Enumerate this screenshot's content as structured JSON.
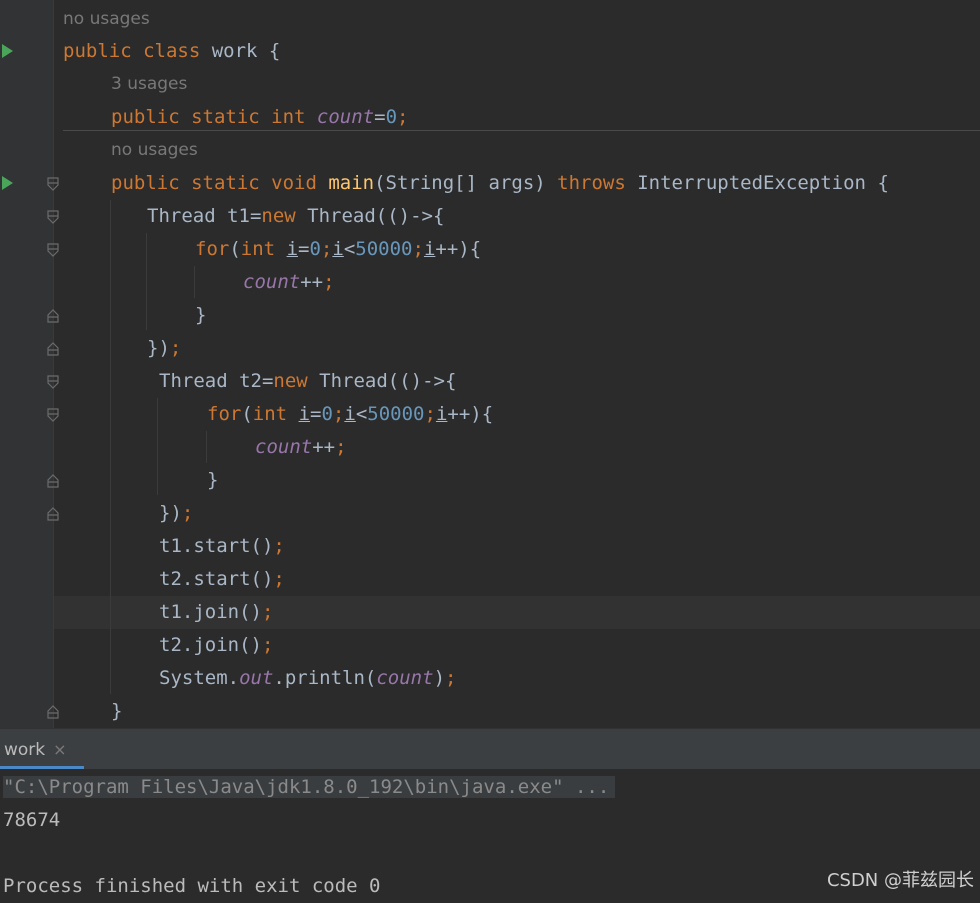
{
  "editor": {
    "hints": {
      "class_usages": "no usages",
      "count_usages": "3 usages",
      "main_usages": "no usages"
    },
    "code": {
      "l1": {
        "kw": "public class ",
        "name": "work",
        "rest": " {"
      },
      "l2": {
        "kw": "public static int ",
        "var": "count",
        "eq": "=",
        "num": "0",
        "semi": ";"
      },
      "l3": {
        "kw": "public static void ",
        "fn": "main",
        "args": "(String[] args) ",
        "throws": "throws",
        "exc": " InterruptedException {"
      },
      "l4": {
        "a": "Thread t1=",
        "kw": "new",
        "b": " Thread(()->{"
      },
      "l5": {
        "kw": "for",
        "a": "(",
        "kw2": "int",
        "sp": " ",
        "i1": "i",
        "eq": "=",
        "n0": "0",
        "s1": ";",
        "i2": "i",
        "lt": "<",
        "n1": "50000",
        "s2": ";",
        "i3": "i",
        "tail": "++){"
      },
      "l6": {
        "var": "count",
        "op": "++",
        "semi": ";"
      },
      "l7": {
        "brace": "}"
      },
      "l8": {
        "a": "})",
        "semi": ";"
      },
      "l9": {
        "a": "Thread t2=",
        "kw": "new",
        "b": " Thread(()->{"
      },
      "l10": {
        "kw": "for",
        "a": "(",
        "kw2": "int",
        "sp": " ",
        "i1": "i",
        "eq": "=",
        "n0": "0",
        "s1": ";",
        "i2": "i",
        "lt": "<",
        "n1": "50000",
        "s2": ";",
        "i3": "i",
        "tail": "++){"
      },
      "l11": {
        "var": "count",
        "op": "++",
        "semi": ";"
      },
      "l12": {
        "brace": "}"
      },
      "l13": {
        "a": "})",
        "semi": ";"
      },
      "l14": {
        "a": "t1.start()",
        "semi": ";"
      },
      "l15": {
        "a": "t2.start()",
        "semi": ";"
      },
      "l16": {
        "a": "t1.join()",
        "semi": ";"
      },
      "l17": {
        "a": "t2.join()",
        "semi": ";"
      },
      "l18": {
        "a": "System.",
        "out": "out",
        "b": ".println(",
        "var": "count",
        "c": ")",
        "semi": ";"
      },
      "l19": {
        "brace": "}"
      }
    }
  },
  "run_panel": {
    "tab_label": "work",
    "close_glyph": "×",
    "command": "\"C:\\Program Files\\Java\\jdk1.8.0_192\\bin\\java.exe\" ...",
    "output": "78674",
    "exit_message": "Process finished with exit code 0"
  },
  "watermark": "CSDN @菲兹园长",
  "colors": {
    "editor_bg": "#2b2b2b",
    "keyword": "#cc7832",
    "function": "#ffc66d",
    "number": "#6897bb",
    "static_field": "#9876aa",
    "text": "#a9b7c6",
    "run_icon": "#4aa55a"
  }
}
